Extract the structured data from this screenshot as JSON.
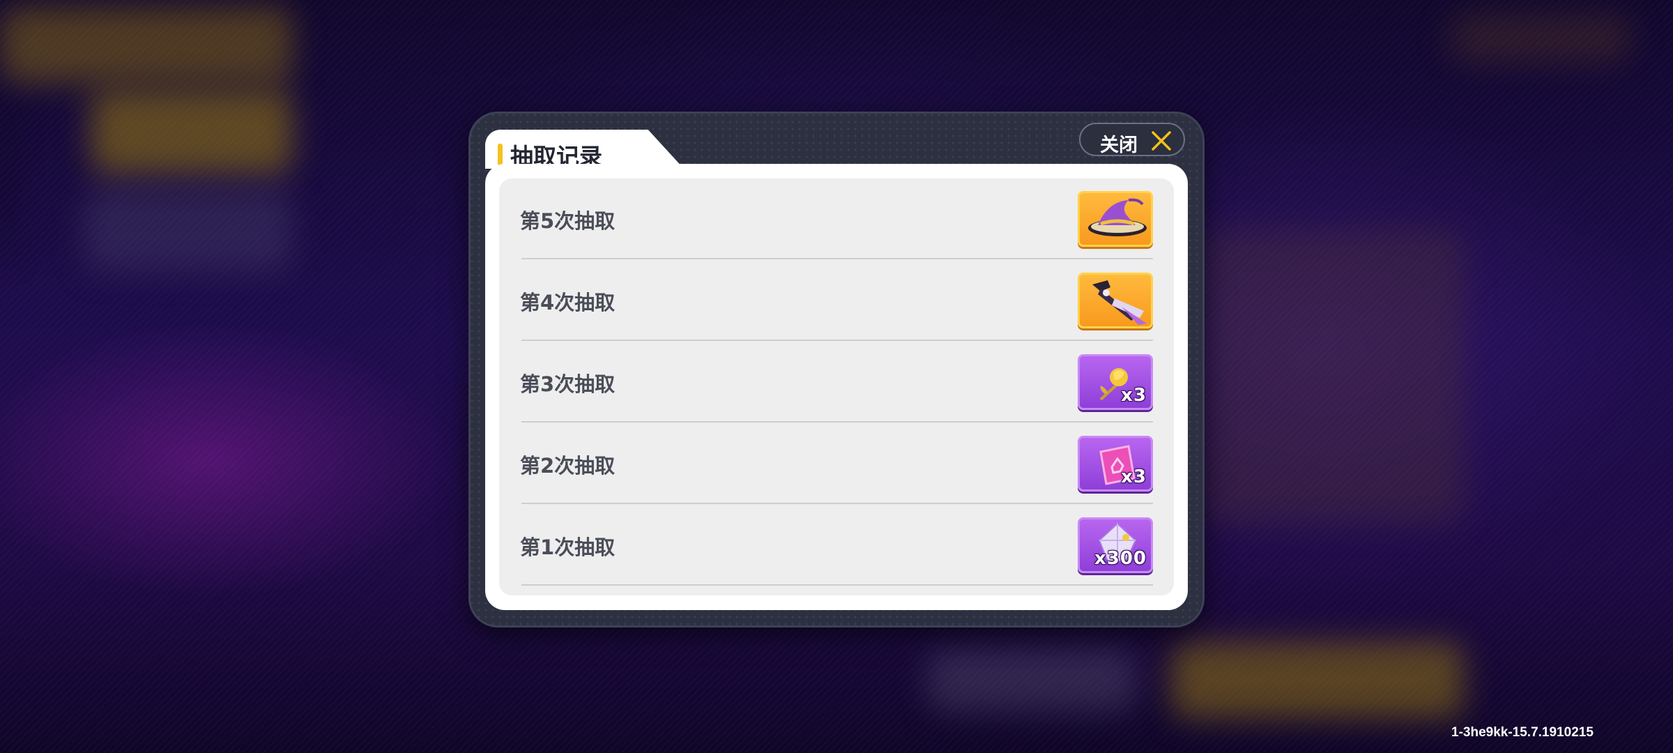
{
  "dialog": {
    "title": "抽取记录",
    "close_label": "关闭"
  },
  "records": [
    {
      "label": "第5次抽取",
      "reward_icon": "witch-hat-icon",
      "rarity": "gold",
      "quantity": ""
    },
    {
      "label": "第4次抽取",
      "reward_icon": "weapon-icon",
      "rarity": "gold",
      "quantity": ""
    },
    {
      "label": "第3次抽取",
      "reward_icon": "golden-rose-icon",
      "rarity": "purple",
      "quantity": "x3"
    },
    {
      "label": "第2次抽取",
      "reward_icon": "pink-card-icon",
      "rarity": "purple",
      "quantity": "x3"
    },
    {
      "label": "第1次抽取",
      "reward_icon": "crystal-icon",
      "rarity": "purple",
      "quantity": "x300"
    }
  ],
  "version_text": "1-3he9kk-15.7.1910215",
  "colors": {
    "accent": "#f4c21c",
    "gold_tile": "#f8a42a",
    "purple_tile": "#a050e6",
    "panel": "#2c3040"
  }
}
